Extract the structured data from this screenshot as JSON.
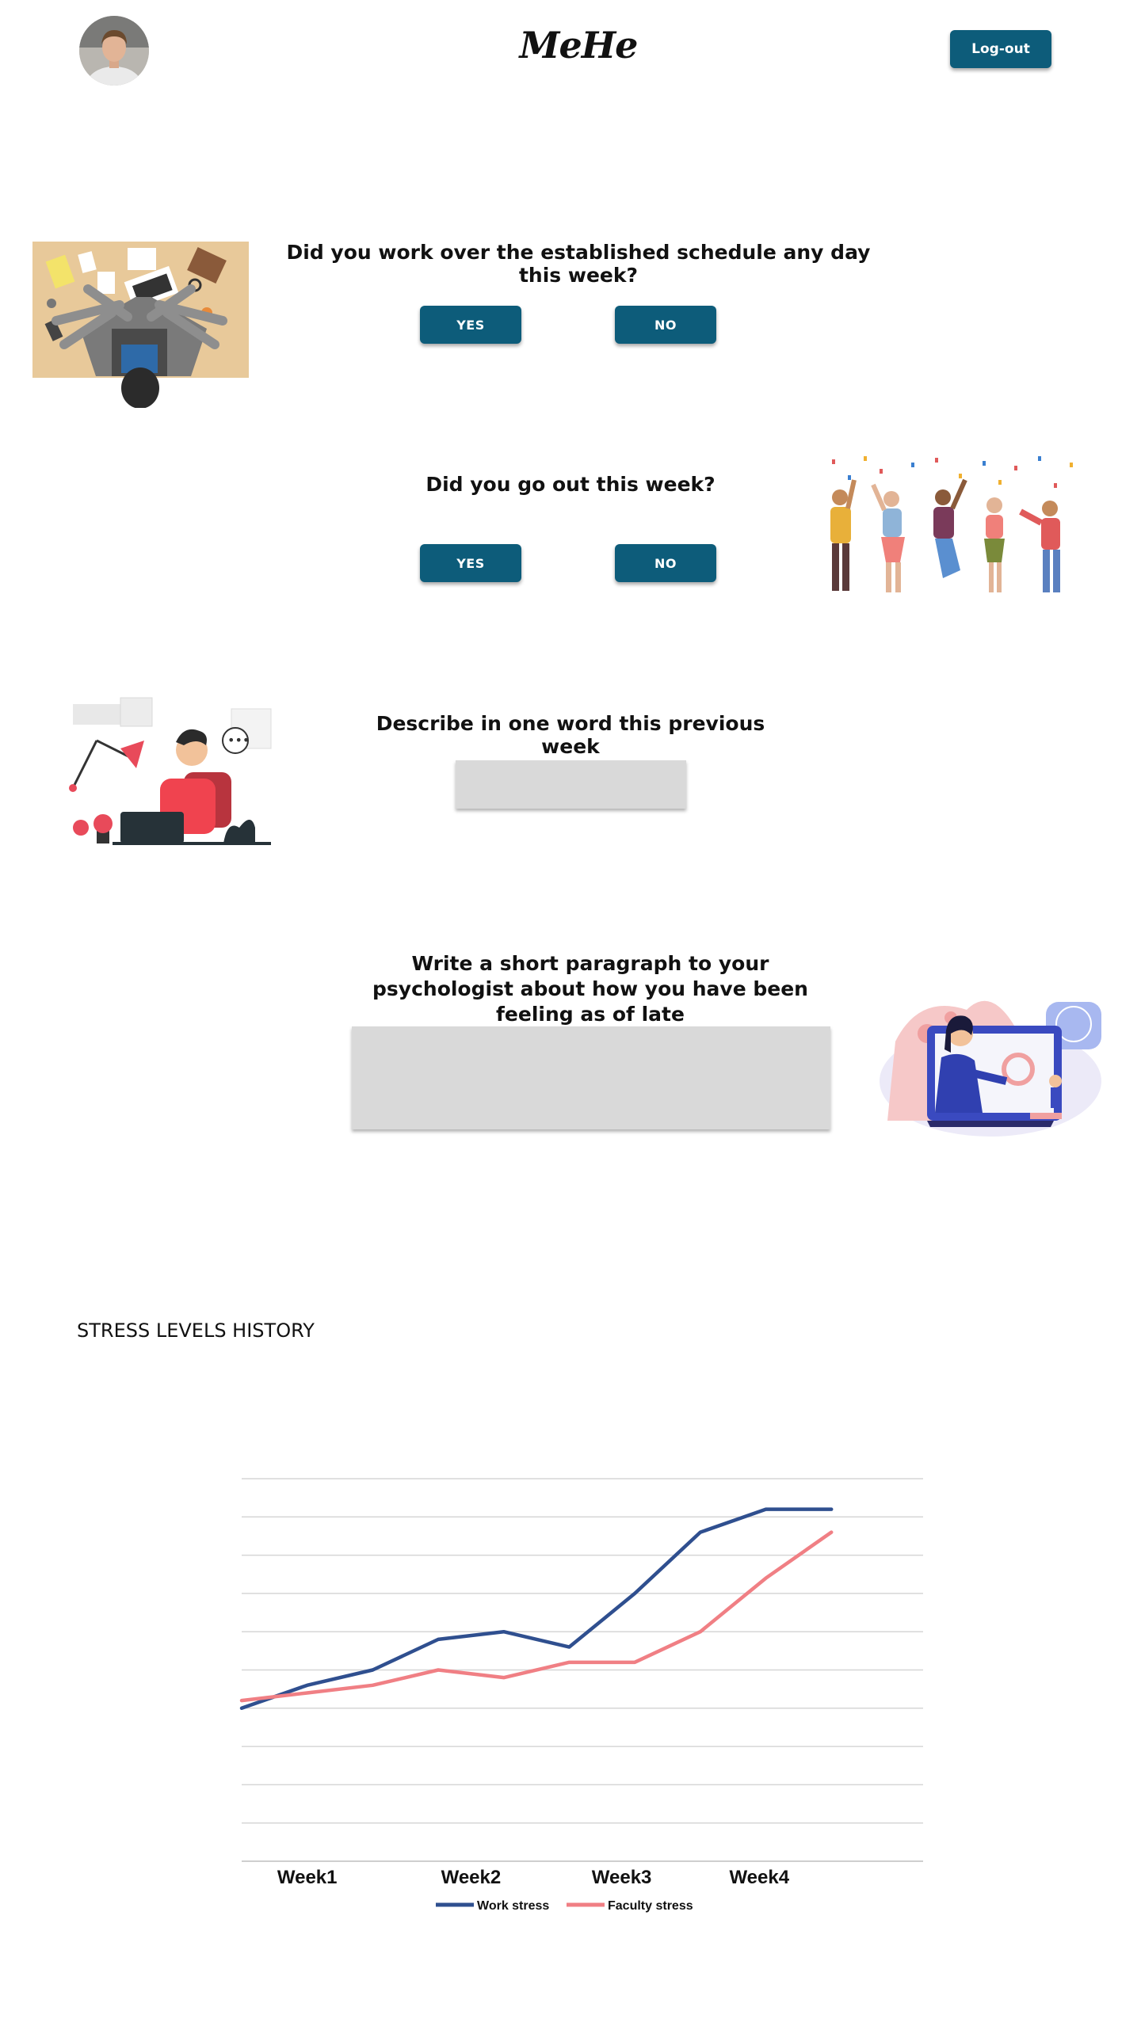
{
  "header": {
    "logo": "MeHe",
    "logout_label": "Log-out"
  },
  "questions": {
    "overtime": {
      "text": "Did you work over the established schedule any day this week?",
      "yes": "YES",
      "no": "NO"
    },
    "went_out": {
      "text": "Did you go out this week?",
      "yes": "YES",
      "no": "NO"
    },
    "one_word": {
      "text": "Describe in one word this previous week",
      "value": ""
    },
    "paragraph": {
      "text": "Write a short paragraph to your psychologist about how you have been feeling as of late",
      "value": ""
    }
  },
  "stress_section": {
    "title": "STRESS LEVELS HISTORY"
  },
  "colors": {
    "button": "#0d5c7a",
    "work_stress": "#2f4f8f",
    "faculty_stress": "#f07f84",
    "field": "#d9d9d9"
  },
  "chart_data": {
    "type": "line",
    "x": [
      0,
      0.5,
      1,
      1.5,
      2,
      2.5,
      3,
      3.5,
      4,
      4.5,
      5,
      5.5,
      6
    ],
    "categories": [
      "Week1",
      "Week2",
      "Week3",
      "Week4"
    ],
    "category_positions": [
      0.5,
      1.75,
      2.9,
      3.95
    ],
    "ylim": [
      0,
      10
    ],
    "grid": true,
    "legend": "bottom-center",
    "series": [
      {
        "name": "Work stress",
        "color": "#2f4f8f",
        "values": [
          4.0,
          4.6,
          5.0,
          5.8,
          6.0,
          5.6,
          7.0,
          8.6,
          9.2,
          9.2
        ]
      },
      {
        "name": "Faculty stress",
        "color": "#f07f84",
        "values": [
          4.2,
          4.4,
          4.6,
          5.0,
          4.8,
          5.2,
          5.2,
          6.0,
          7.4,
          8.6
        ]
      }
    ]
  }
}
